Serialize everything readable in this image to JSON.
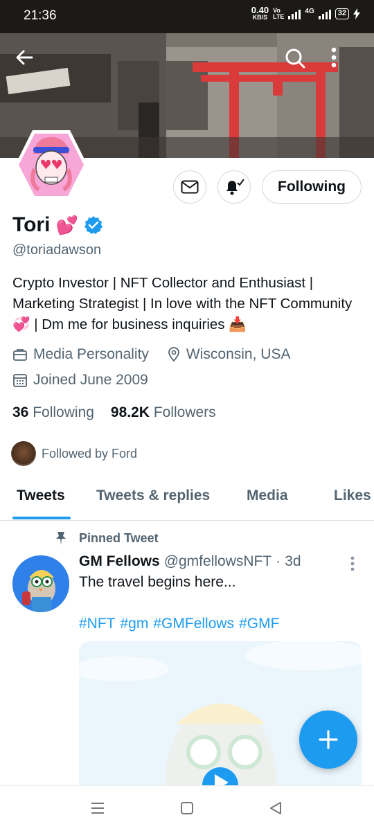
{
  "status_bar": {
    "time": "21:36",
    "speed_value": "0.40",
    "speed_unit": "KB/S",
    "volte_top": "Vo",
    "volte_bottom": "LTE",
    "network": "4G",
    "battery": "32"
  },
  "header": {
    "back_icon": "arrow-left-icon",
    "search_icon": "search-icon",
    "more_icon": "more-vertical-icon"
  },
  "profile": {
    "name": "Tori",
    "name_emoji": "💕",
    "verified": true,
    "handle": "@toriadawson",
    "bio": "Crypto Investor | NFT Collector and Enthusiast | Marketing Strategist | In love with the NFT Community 💞 | Dm me for business inquiries 📥",
    "category": "Media Personality",
    "location": "Wisconsin, USA",
    "joined": "Joined June 2009",
    "following_count": "36",
    "following_label": "Following",
    "followers_count": "98.2K",
    "followers_label": "Followers",
    "followed_by": "Followed by Ford",
    "follow_button_label": "Following"
  },
  "tabs": [
    {
      "label": "Tweets",
      "active": true
    },
    {
      "label": "Tweets & replies",
      "active": false
    },
    {
      "label": "Media",
      "active": false
    },
    {
      "label": "Likes",
      "active": false
    }
  ],
  "tweet": {
    "pinned_label": "Pinned Tweet",
    "author_name": "GM Fellows",
    "author_handle": "@gmfellowsNFT",
    "separator": "·",
    "age": "3d",
    "text": "The travel begins here...",
    "hashtags": [
      "#NFT",
      "#gm",
      "#GMFellows",
      "#GMF"
    ]
  },
  "colors": {
    "accent": "#1d9bf0",
    "text_primary": "#0f1419",
    "text_secondary": "#536471"
  }
}
